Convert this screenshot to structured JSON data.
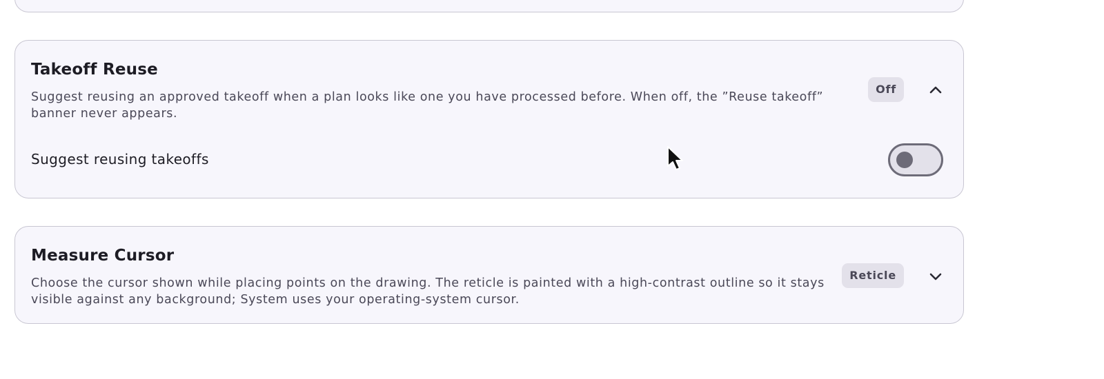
{
  "sections": {
    "takeoff_reuse": {
      "title": "Takeoff Reuse",
      "description": "Suggest reusing an approved takeoff when a plan looks like one you have processed before. When off, the ”Reuse takeoff” banner never appears.",
      "badge": "Off",
      "expanded": true,
      "chevron_icon": "chevron-up-icon",
      "setting": {
        "label": "Suggest reusing takeoffs",
        "enabled": false
      }
    },
    "measure_cursor": {
      "title": "Measure Cursor",
      "description": "Choose the cursor shown while placing points on the drawing. The reticle is painted with a high-contrast outline so it stays visible against any background; System uses your operating-system cursor.",
      "badge": "Reticle",
      "expanded": false,
      "chevron_icon": "chevron-down-icon"
    }
  },
  "colors": {
    "card_background": "#f7f6fc",
    "card_border": "#c8c6d2",
    "badge_background": "#e3e1ea",
    "toggle_off": "#6d6b78"
  }
}
